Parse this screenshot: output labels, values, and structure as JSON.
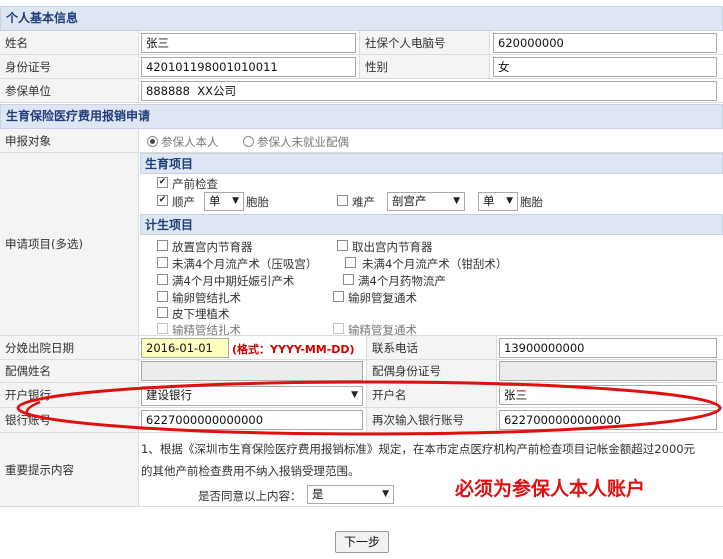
{
  "personal": {
    "header": "个人基本信息",
    "name_label": "姓名",
    "name_value": "张三",
    "pc_no_label": "社保个人电脑号",
    "pc_no_value": "620000000",
    "id_label": "身份证号",
    "id_value": "420101198001010011",
    "gender_label": "性别",
    "gender_value": "女",
    "employer_label": "参保单位",
    "employer_value": "888888  XX公司"
  },
  "application": {
    "header": "生育保险医疗费用报销申请",
    "target_label": "申报对象",
    "target_options": [
      "参保人本人",
      "参保人未就业配偶"
    ],
    "items_label": "申请项目(多选)",
    "birth_section": "生育项目",
    "prenatal": "产前检查",
    "natural": "顺产",
    "natural_count": "单",
    "fetus": "胞胎",
    "difficult": "难产",
    "difficult_type": "剖宫产",
    "difficult_count": "单",
    "fetus2": "胞胎",
    "family_section": "计生项目",
    "family_items": [
      "放置宫内节育器",
      "取出宫内节育器",
      "未满4个月流产术（压吸宫）",
      "未满4个月流产术（钳刮术）",
      "满4个月中期妊娠引产术",
      "满4个月药物流产",
      "输卵管结扎术",
      "输卵管复通术",
      "皮下埋植术",
      "输精管结扎术",
      "输精管复通术"
    ],
    "discharge_label": "分娩出院日期",
    "discharge_value": "2016-01-01",
    "discharge_hint": "(格式：YYYY-MM-DD)",
    "phone_label": "联系电话",
    "phone_value": "13900000000",
    "spouse_name_label": "配偶姓名",
    "spouse_id_label": "配偶身份证号",
    "bank_label": "开户银行",
    "bank_value": "建设银行",
    "account_name_label": "开户名",
    "account_name_value": "张三",
    "account_label": "银行账号",
    "account_value": "6227000000000000",
    "account_confirm_label": "再次输入银行账号",
    "account_confirm_value": "6227000000000000",
    "notice_label": "重要提示内容",
    "notice_line1": "1、根据《深圳市生育保险医疗费用报销标准》规定，在本市定点医疗机构产前检查项目记帐金额超过2000元",
    "notice_line2": "的其他产前检查费用不纳入报销受理范围。",
    "agree_label": "是否同意以上内容：",
    "agree_value": "是",
    "annotation": "必须为参保人本人账户"
  },
  "next_button": "下一步",
  "colors": {
    "header_bg": "#dfe6f3",
    "header_text": "#1f3d7a",
    "annotation": "#e01010",
    "hint": "#d00000"
  }
}
